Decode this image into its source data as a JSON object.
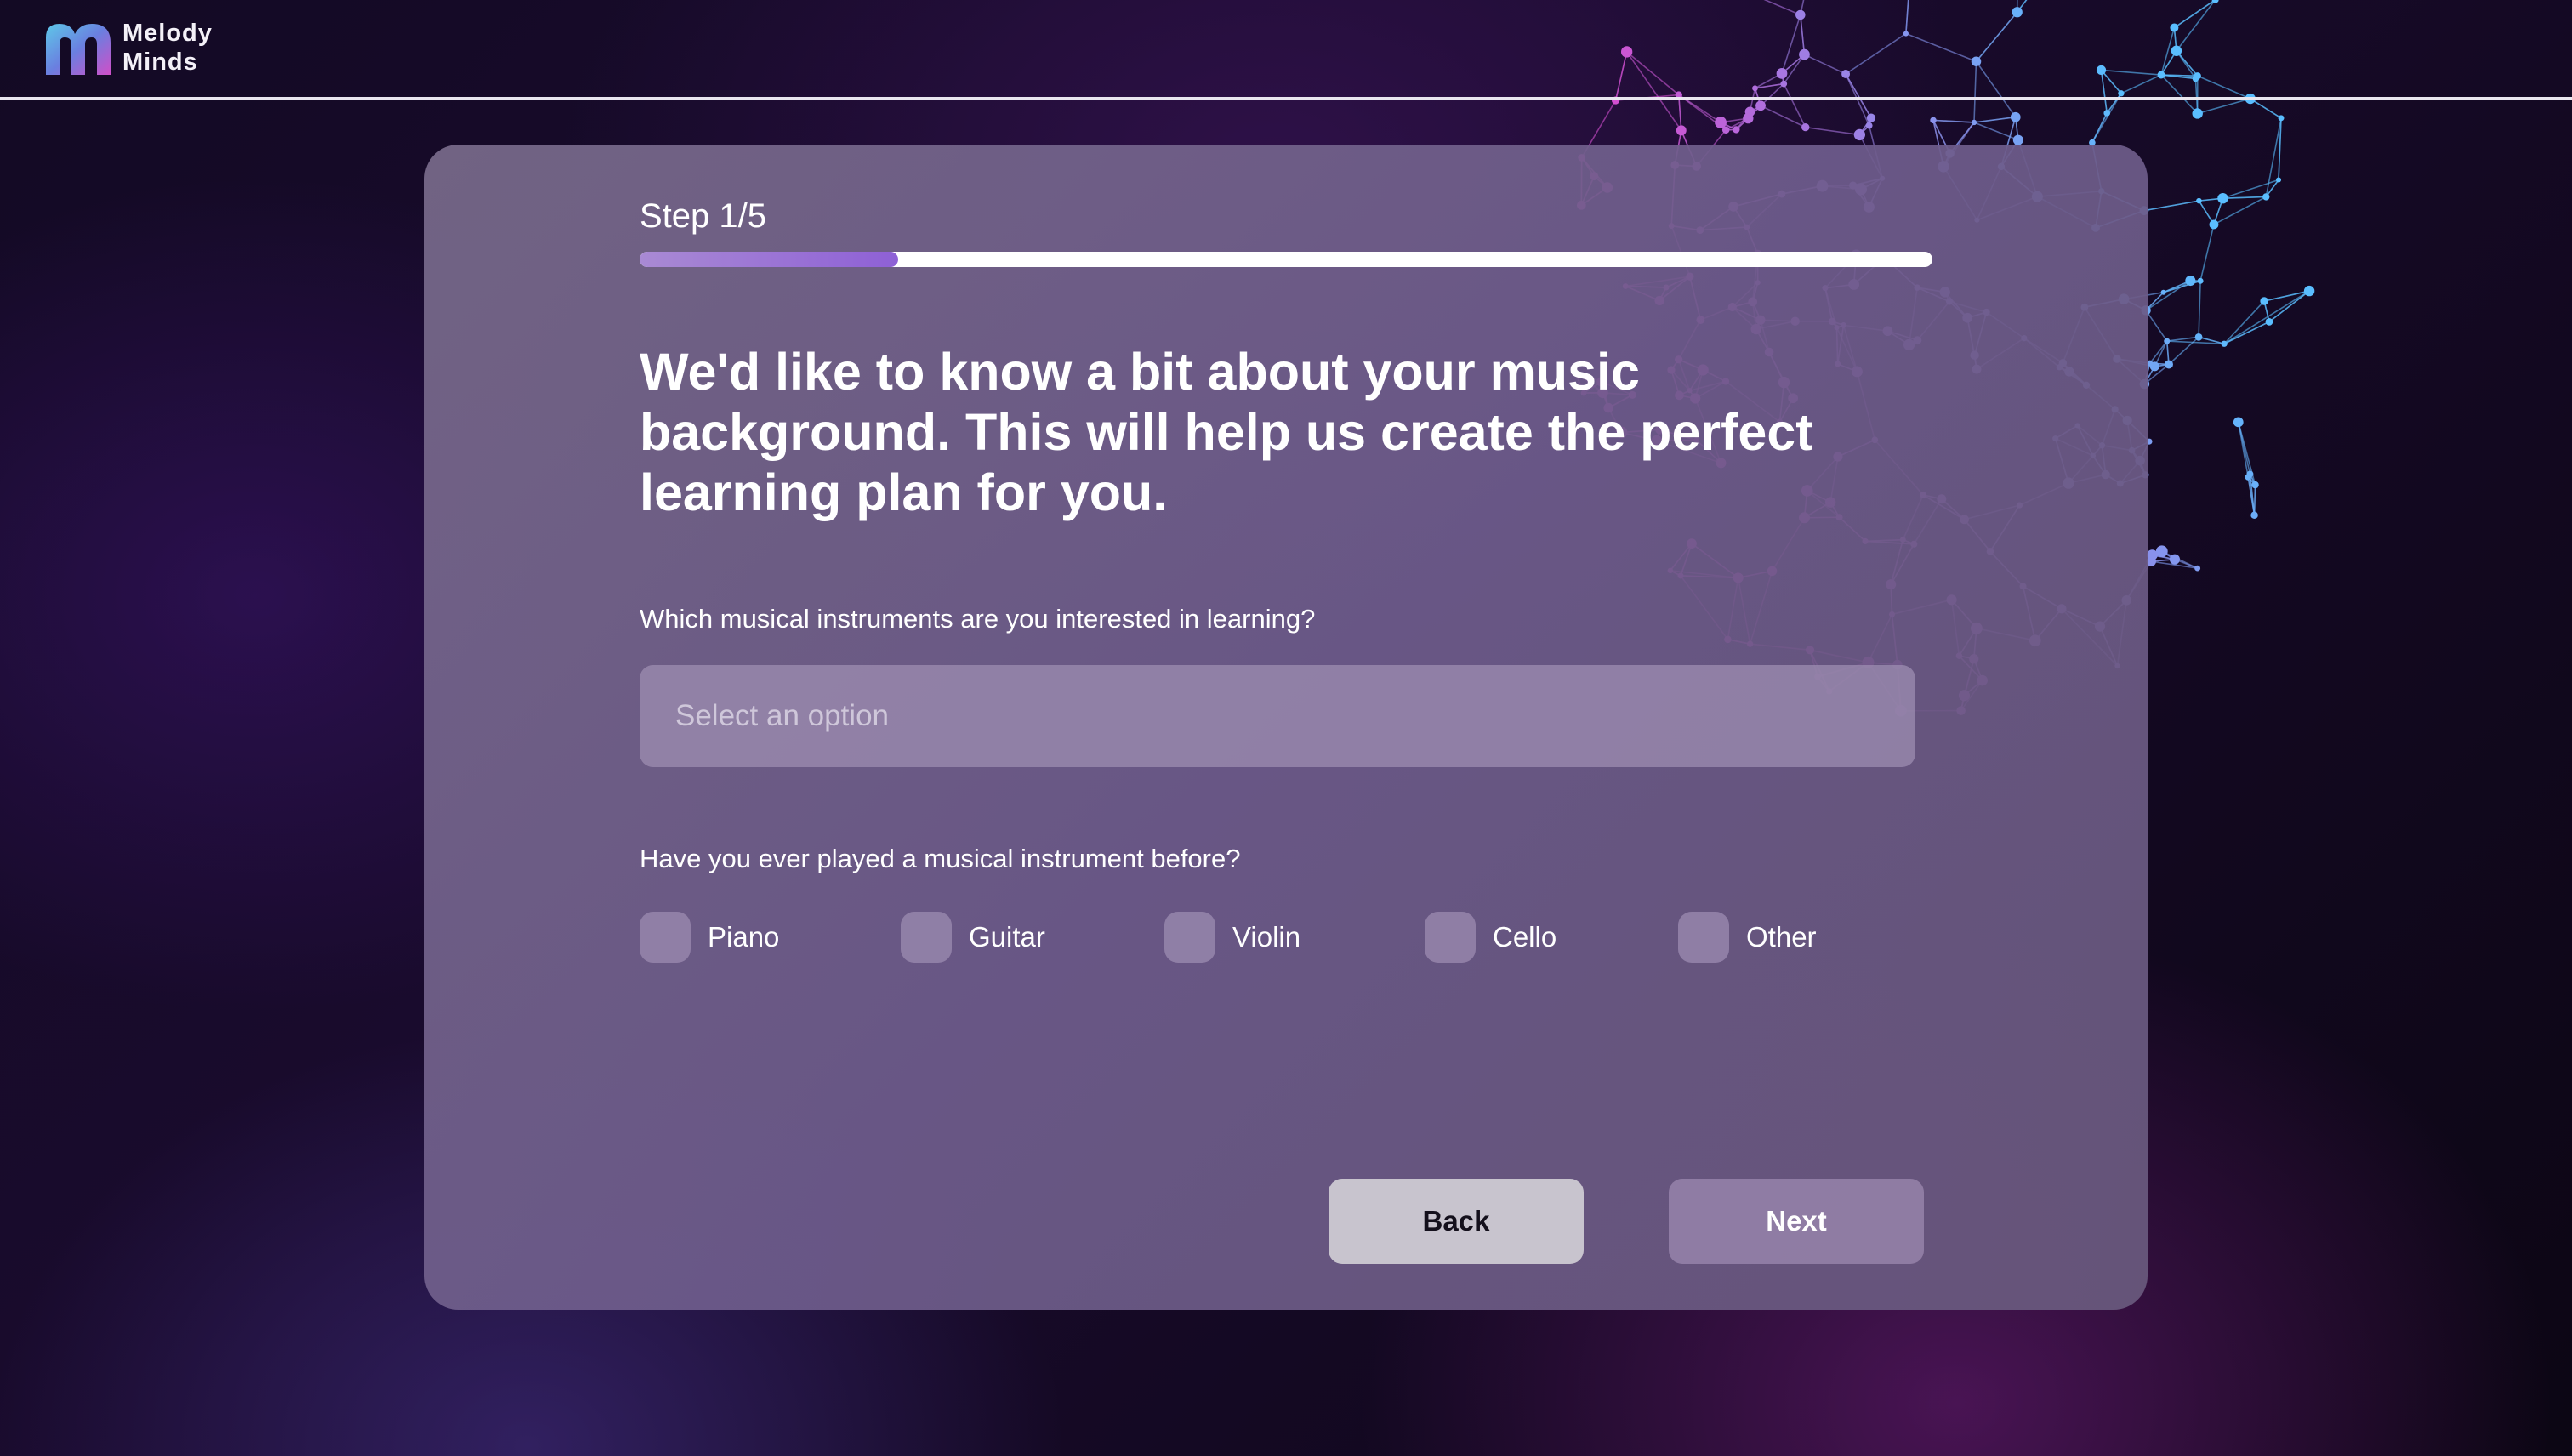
{
  "app": {
    "brand_line1": "Melody",
    "brand_line2": "Minds",
    "colors": {
      "accent": "#8e60d6",
      "card": "#6e5c8c",
      "back_button": "#c8c4ce"
    }
  },
  "onboarding": {
    "step_label": "Step 1/5",
    "progress_fraction": 0.2,
    "heading": "We'd like to know a bit about your music background. This will help us create the perfect learning plan for you.",
    "question1": {
      "label": "Which musical instruments are you interested in learning?",
      "placeholder": "Select an option",
      "icon": "none"
    },
    "question2": {
      "label": "Have you ever played a musical instrument before?",
      "options": [
        "Piano",
        "Guitar",
        "Violin",
        "Cello",
        "Other"
      ],
      "checked": [
        false,
        false,
        false,
        false,
        false
      ]
    },
    "buttons": {
      "back": "Back",
      "next": "Next"
    }
  }
}
